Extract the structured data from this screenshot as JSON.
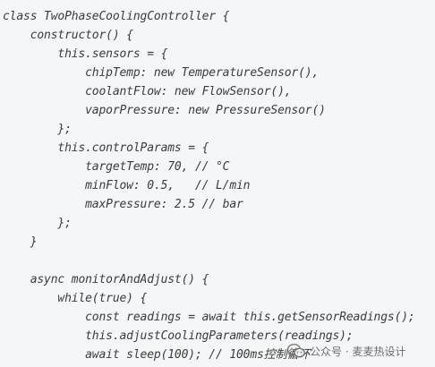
{
  "code": {
    "lines": [
      "class TwoPhaseCoolingController {",
      "    constructor() {",
      "        this.sensors = {",
      "            chipTemp: new TemperatureSensor(),",
      "            coolantFlow: new FlowSensor(),",
      "            vaporPressure: new PressureSensor()",
      "        };",
      "        this.controlParams = {",
      "            targetTemp: 70, // °C",
      "            minFlow: 0.5,   // L/min",
      "            maxPressure: 2.5 // bar",
      "        };",
      "    }",
      "",
      "    async monitorAndAdjust() {",
      "        while(true) {",
      "            const readings = await this.getSensorReadings();",
      "            this.adjustCoolingParameters(readings);",
      "            await sleep(100); // 100ms控制循环"
    ]
  },
  "watermark": {
    "text": "公众号 · 麦麦热设计",
    "icon": "wechat-logo-icon"
  },
  "colors": {
    "background": "#f5f6f7",
    "text": "#3b3b3b"
  }
}
